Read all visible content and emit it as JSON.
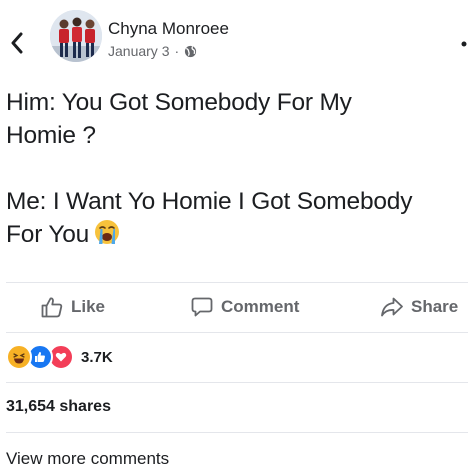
{
  "header": {
    "author_name": "Chyna Monroee",
    "date": "January 3",
    "separator": "·",
    "privacy_icon": "globe-icon",
    "back_icon": "chevron-left-icon",
    "more_icon": "dot-menu-icon"
  },
  "post": {
    "lines": [
      "Him: You Got Somebody For My",
      "Homie ?",
      "Me: I Want Yo Homie I Got Somebody",
      "For You"
    ],
    "emoji": "loudly-crying-face-icon"
  },
  "actions": {
    "like_label": "Like",
    "comment_label": "Comment",
    "share_label": "Share"
  },
  "reactions": {
    "icons": [
      "haha-icon",
      "like-icon",
      "love-icon"
    ],
    "count": "3.7K"
  },
  "shares": "31,654 shares",
  "view_more": "View more comments",
  "colors": {
    "text": "#1c1e21",
    "secondary": "#65676b",
    "like_blue": "#1877f2",
    "love_red": "#f33e58",
    "haha_yellow": "#f7b125"
  }
}
